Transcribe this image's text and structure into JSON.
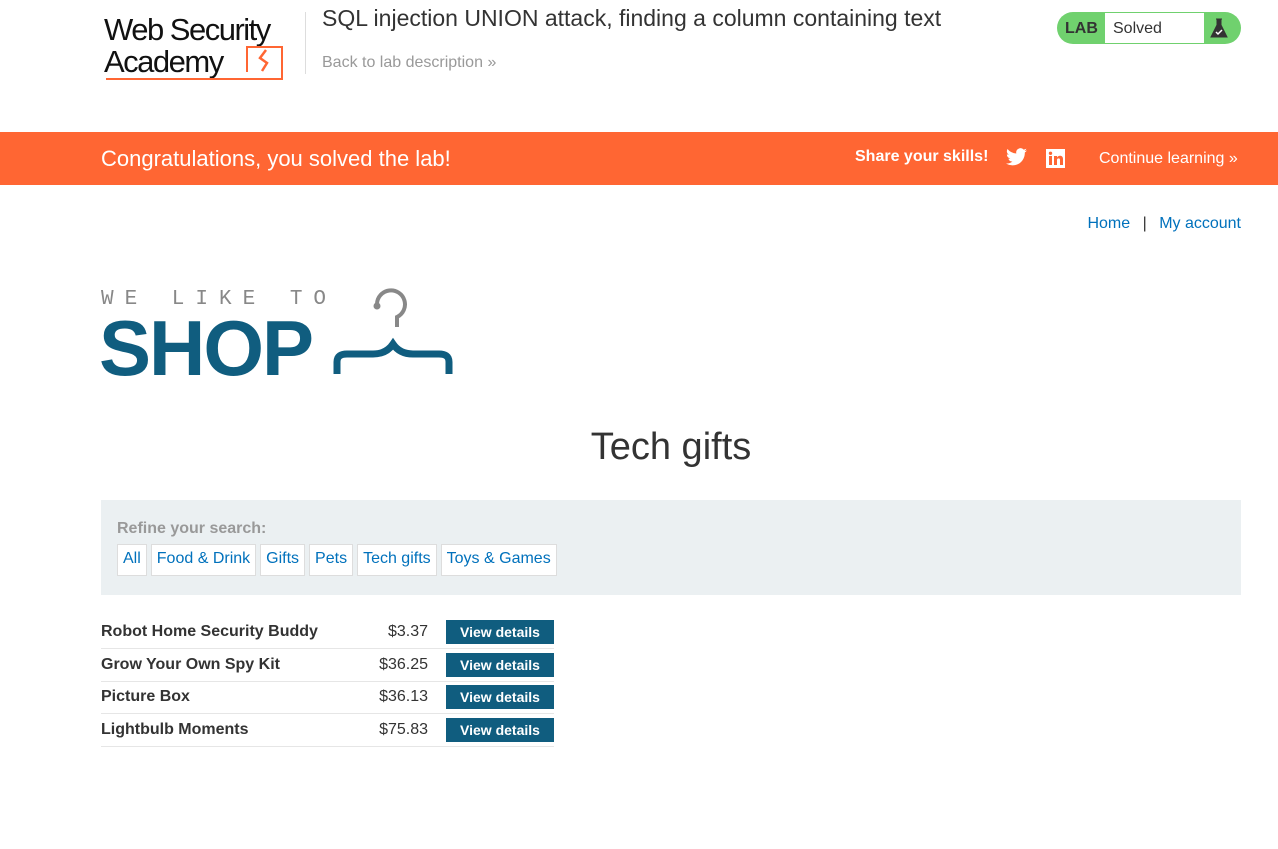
{
  "header": {
    "logo_text": "Web Security Academy",
    "lab_title": "SQL injection UNION attack, finding a column containing text",
    "back_link": "Back to lab description",
    "badge_label": "LAB",
    "status": "Solved"
  },
  "banner": {
    "message": "Congratulations, you solved the lab!",
    "share": "Share your skills!",
    "continue": "Continue learning"
  },
  "nav": {
    "home": "Home",
    "separator": "|",
    "account": "My account"
  },
  "shop_logo": {
    "top": "WE LIKE TO",
    "bottom": "SHOP"
  },
  "page_title": "Tech gifts",
  "filter": {
    "label": "Refine your search:",
    "categories": [
      "All",
      "Food & Drink",
      "Gifts",
      "Pets",
      "Tech gifts",
      "Toys & Games"
    ]
  },
  "products": [
    {
      "name": "Robot Home Security Buddy",
      "price": "$3.37",
      "button": "View details"
    },
    {
      "name": "Grow Your Own Spy Kit",
      "price": "$36.25",
      "button": "View details"
    },
    {
      "name": "Picture Box",
      "price": "$36.13",
      "button": "View details"
    },
    {
      "name": "Lightbulb Moments",
      "price": "$75.83",
      "button": "View details"
    }
  ],
  "colors": {
    "accent": "#ff6633",
    "brand": "#105d7f",
    "link": "#0071bc",
    "solved": "#70d16e"
  }
}
